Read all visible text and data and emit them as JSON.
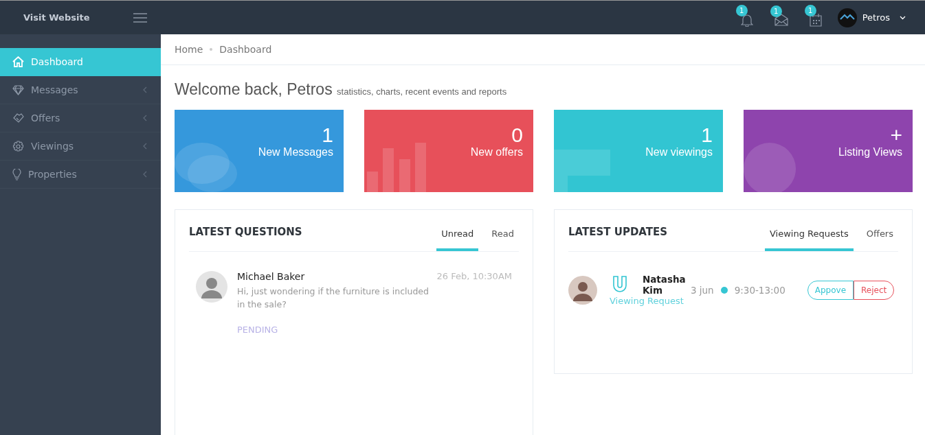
{
  "topbar": {
    "brand": "Visit Website",
    "notifications": [
      {
        "count": "1"
      },
      {
        "count": "1"
      },
      {
        "count": "1"
      }
    ],
    "user": "Petros"
  },
  "sidebar": {
    "items": [
      {
        "label": "Dashboard",
        "selected": true
      },
      {
        "label": "Messages",
        "selected": false
      },
      {
        "label": "Offers",
        "selected": false
      },
      {
        "label": "Viewings",
        "selected": false
      },
      {
        "label": "Properties",
        "selected": false
      }
    ]
  },
  "breadcrumb": [
    "Home",
    "Dashboard"
  ],
  "heading": {
    "title": "Welcome back, Petros",
    "subtitle": "statistics, charts, recent events and reports"
  },
  "stats": [
    {
      "value": "1",
      "label": "New Messages",
      "color": "#3598dc"
    },
    {
      "value": "0",
      "label": "New offers",
      "color": "#e7505a"
    },
    {
      "value": "1",
      "label": "New viewings",
      "color": "#32c5d2"
    },
    {
      "value": "+",
      "label": "Listing Views",
      "color": "#8e44ad"
    }
  ],
  "questions": {
    "title": "LATEST QUESTIONS",
    "tabs": [
      {
        "label": "Unread",
        "selected": true
      },
      {
        "label": "Read",
        "selected": false
      }
    ],
    "items": [
      {
        "name": "Michael Baker",
        "time": "26 Feb, 10:30AM",
        "text": "Hi, just wondering if the furniture is included in the sale?",
        "status": "PENDING"
      }
    ]
  },
  "updates": {
    "title": "LATEST UPDATES",
    "tabs": [
      {
        "label": "Viewing Requests",
        "selected": true
      },
      {
        "label": "Offers",
        "selected": false
      }
    ],
    "items": [
      {
        "name": "Natasha Kim",
        "type": "Viewing Request",
        "date": "3 jun",
        "time": "9:30-13:00",
        "approve": "Appove",
        "reject": "Reject"
      }
    ]
  }
}
